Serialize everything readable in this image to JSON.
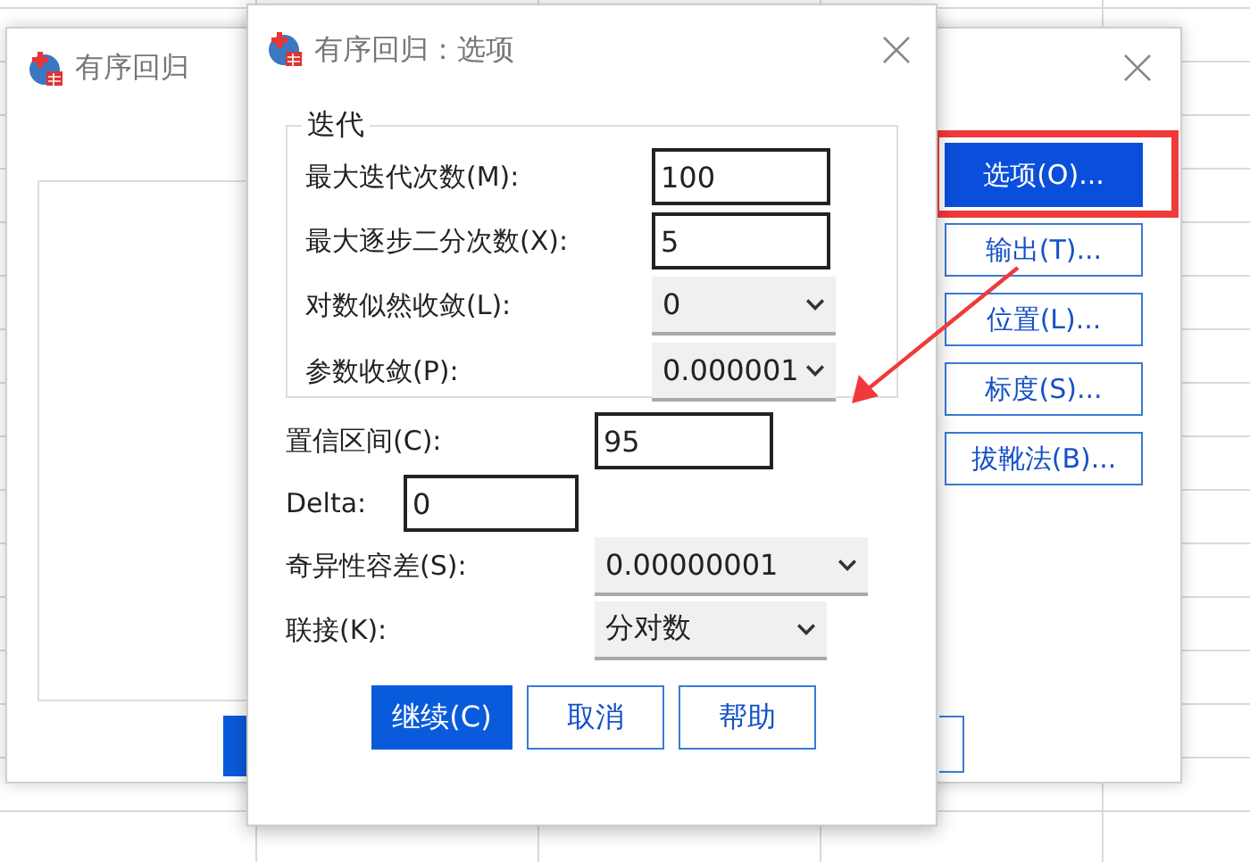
{
  "back_window": {
    "title": "有序回归",
    "side_buttons": [
      {
        "label": "选项(O)...",
        "selected": true
      },
      {
        "label": "输出(T)...",
        "selected": false
      },
      {
        "label": "位置(L)...",
        "selected": false
      },
      {
        "label": "标度(S)...",
        "selected": false
      },
      {
        "label": "拔靴法(B)...",
        "selected": false
      }
    ]
  },
  "dialog": {
    "title": "有序回归：选项",
    "group": {
      "title": "迭代",
      "rows": [
        {
          "label": "最大迭代次数(M):",
          "kind": "input",
          "value": "100"
        },
        {
          "label": "最大逐步二分次数(X):",
          "kind": "input",
          "value": "5"
        },
        {
          "label": "对数似然收敛(L):",
          "kind": "select",
          "value": "0"
        },
        {
          "label": "参数收敛(P):",
          "kind": "select",
          "value": "0.000001"
        }
      ]
    },
    "rows": [
      {
        "label": "置信区间(C):",
        "kind": "input",
        "value": "95"
      },
      {
        "label": "Delta:",
        "kind": "input",
        "value": "0"
      },
      {
        "label": "奇异性容差(S):",
        "kind": "select",
        "value": "0.00000001"
      },
      {
        "label": "联接(K):",
        "kind": "select",
        "value": "分对数"
      }
    ],
    "buttons": [
      {
        "label": "继续(C)",
        "primary": true
      },
      {
        "label": "取消",
        "primary": false
      },
      {
        "label": "帮助",
        "primary": false
      }
    ]
  }
}
